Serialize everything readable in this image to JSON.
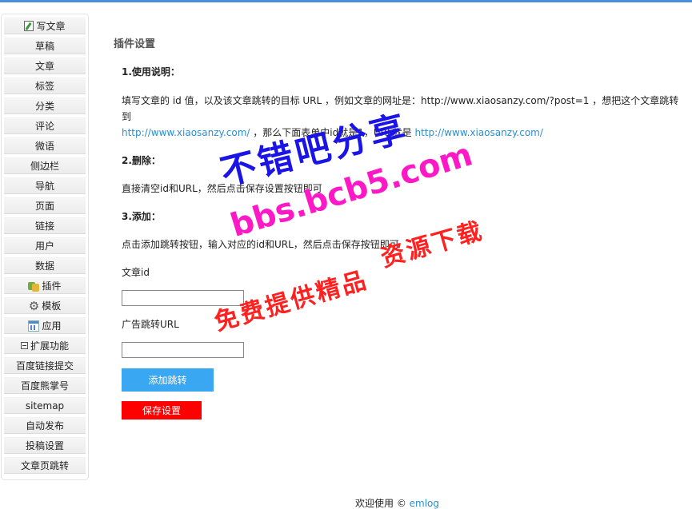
{
  "sidebar": {
    "items": [
      {
        "label": "写文章",
        "icon": "pen-icon"
      },
      {
        "label": "草稿"
      },
      {
        "label": "文章"
      },
      {
        "label": "标签"
      },
      {
        "label": "分类"
      },
      {
        "label": "评论"
      },
      {
        "label": "微语"
      },
      {
        "label": "侧边栏"
      },
      {
        "label": "导航"
      },
      {
        "label": "页面"
      },
      {
        "label": "链接"
      },
      {
        "label": "用户"
      },
      {
        "label": "数据"
      },
      {
        "label": "插件",
        "icon": "plugin-icon"
      },
      {
        "label": "模板",
        "icon": "gear-icon"
      },
      {
        "label": "应用",
        "icon": "app-icon"
      },
      {
        "label": "扩展功能",
        "icon": "collapse-box-icon"
      },
      {
        "label": "百度链接提交"
      },
      {
        "label": "百度熊掌号"
      },
      {
        "label": "sitemap"
      },
      {
        "label": "自动发布"
      },
      {
        "label": "投稿设置"
      },
      {
        "label": "文章页跳转"
      }
    ]
  },
  "main": {
    "title": "插件设置",
    "s1_heading": "1.使用说明：",
    "s1_text_a": "填写文章的 id 值，以及该文章跳转的目标 URL ，例如文章的网址是：http://www.xiaosanzy.com/?post=1 ，想把这个文章跳转到",
    "s1_link_a": "http://www.xiaosanzy.com/",
    "s1_text_b": " ，那么下面表单中id就是1，URL就是 ",
    "s1_link_b": "http://www.xiaosanzy.com/",
    "s2_heading": "2.删除：",
    "s2_text": "直接清空id和URL，然后点击保存设置按钮即可",
    "s3_heading": "3.添加：",
    "s3_text": "点击添加跳转按钮，输入对应的id和URL，然后点击保存按钮即可",
    "id_label": "文章id",
    "id_value": "",
    "url_label": "广告跳转URL",
    "url_value": "",
    "add_button": "添加跳转",
    "save_button": "保存设置"
  },
  "footer": {
    "text": "欢迎使用 © ",
    "link": "emlog"
  },
  "watermark": {
    "line1": "不错吧分享",
    "line2": "bbs.bcb5.com",
    "line3": "资源下载",
    "line4": "免费提供精品"
  },
  "colors": {
    "accent": "#3aa7f2",
    "save": "#ff0000",
    "link": "#2a8fd2"
  }
}
